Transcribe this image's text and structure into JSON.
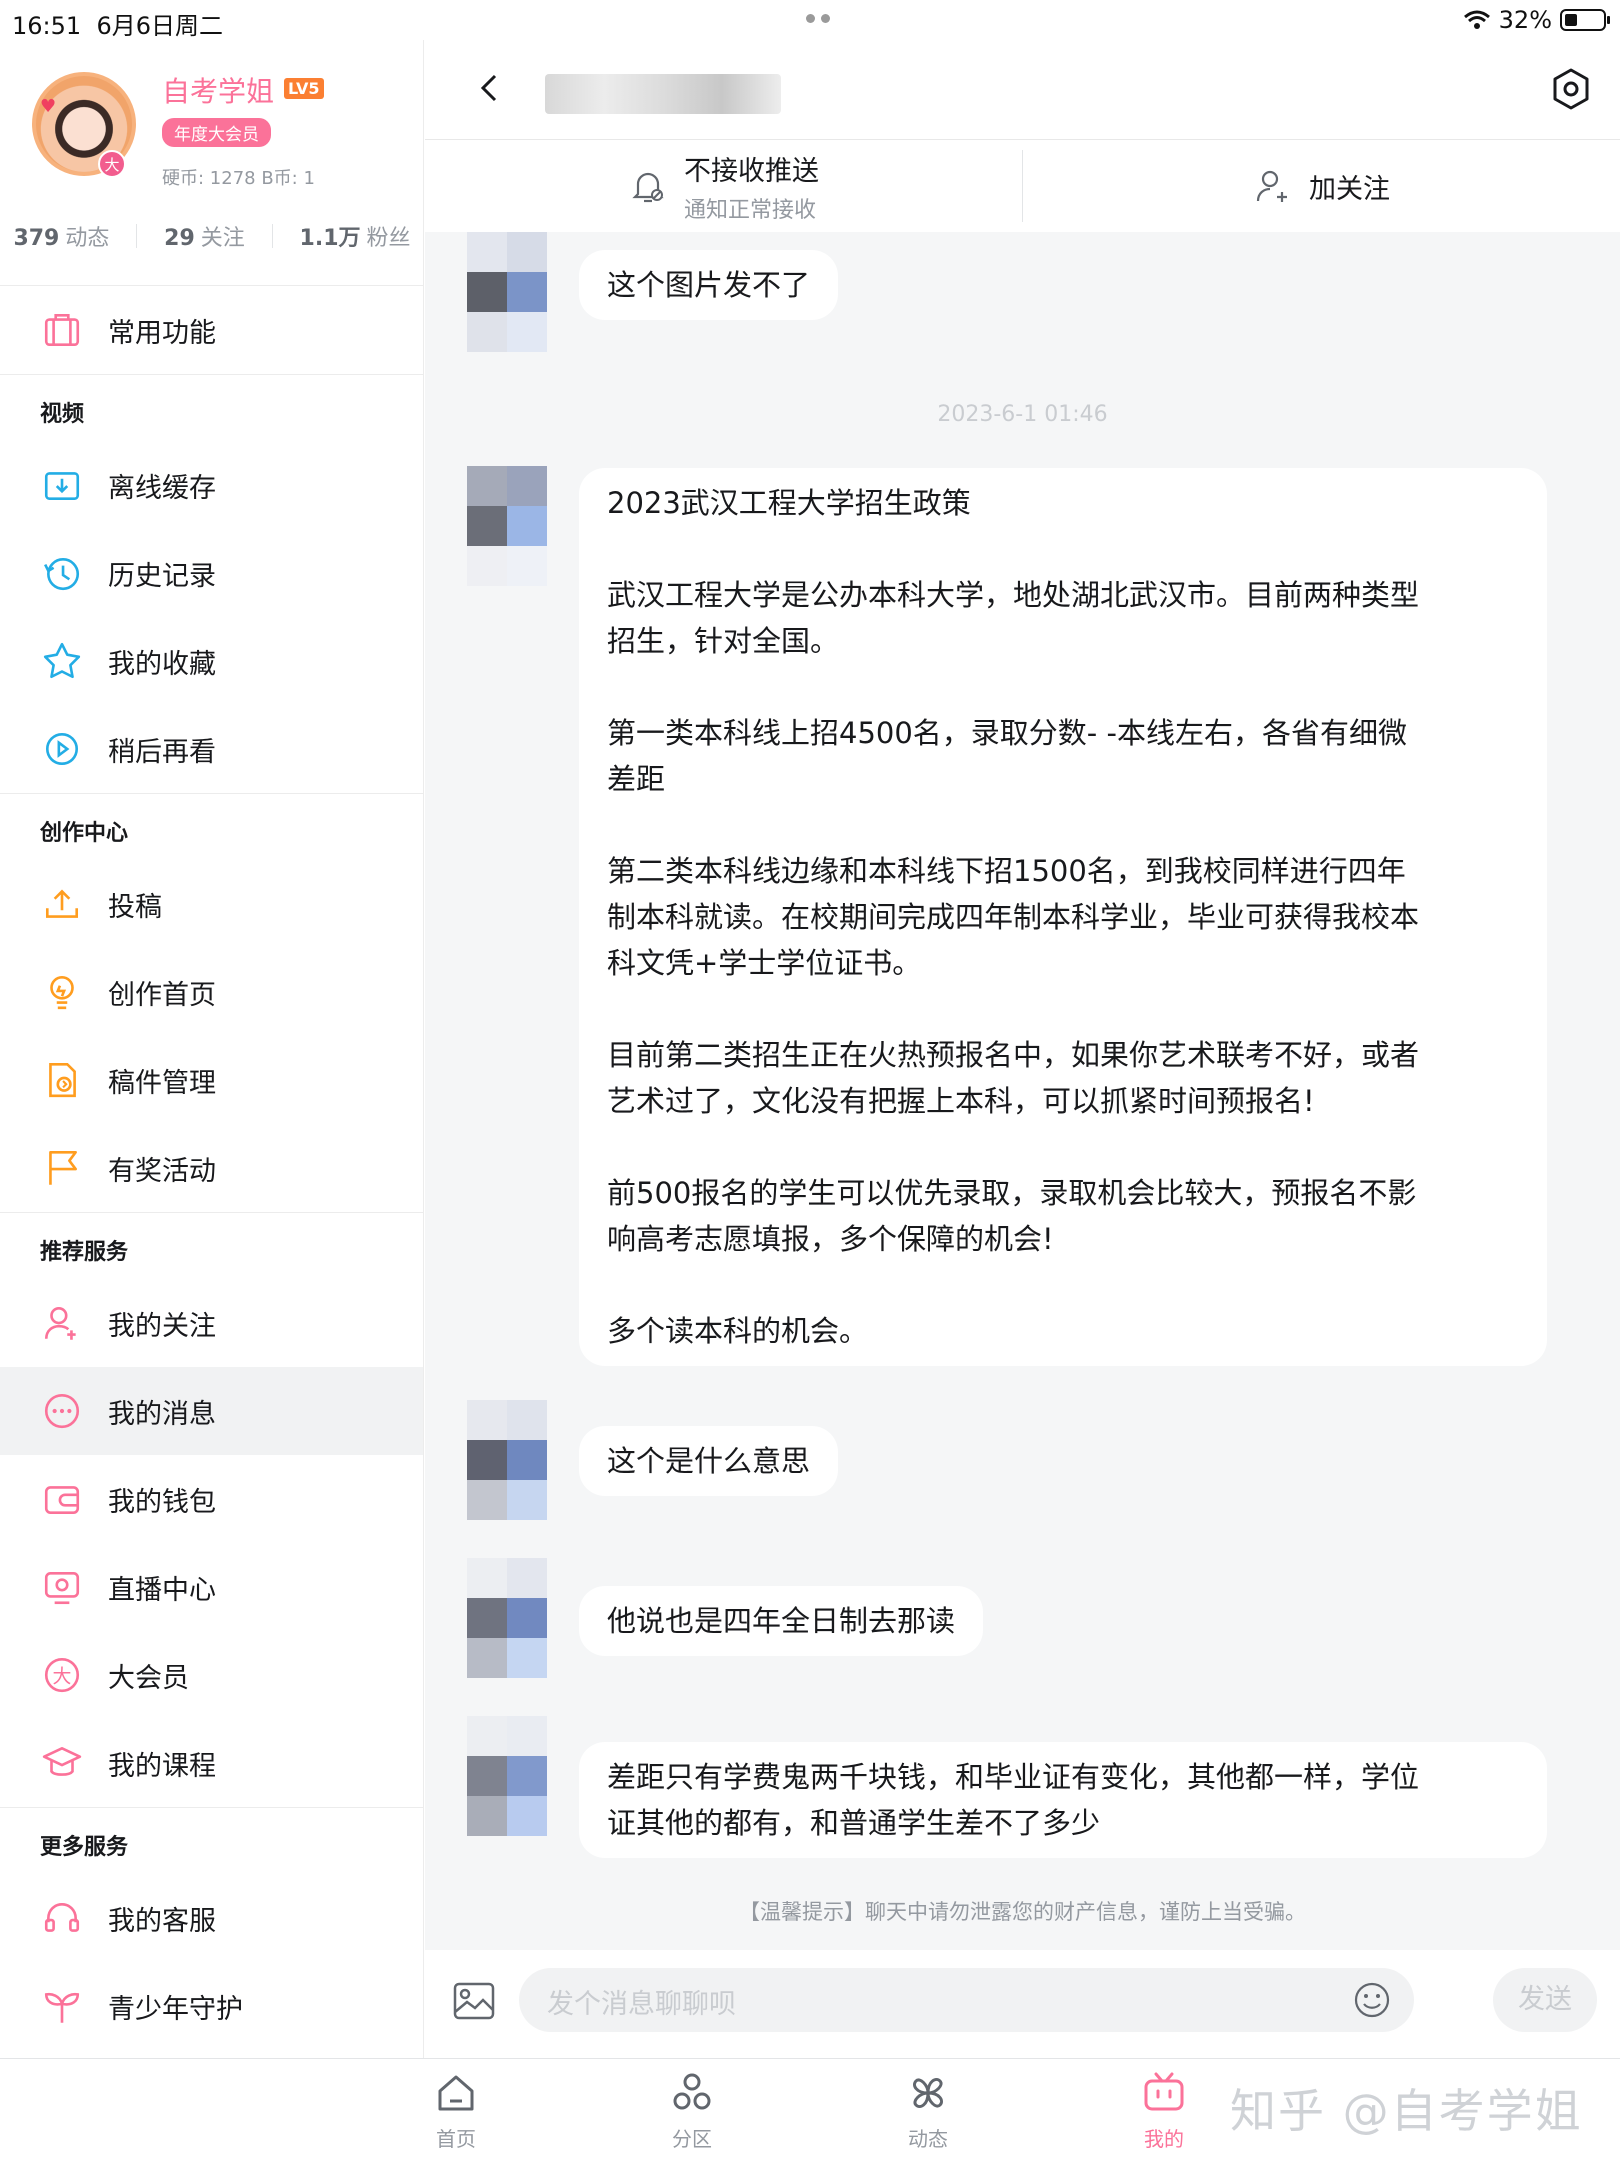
{
  "status": {
    "time": "16:51",
    "date": "6月6日周二",
    "battery": "32%"
  },
  "profile": {
    "name": "自考学姐",
    "level": "LV5",
    "vip": "年度大会员",
    "avatar_badge": "大",
    "coins": "硬币: 1278   B币: 1",
    "stats": [
      {
        "n": "379",
        "l": "动态"
      },
      {
        "n": "29",
        "l": "关注"
      },
      {
        "n": "1.1万",
        "l": "粉丝"
      }
    ]
  },
  "menu": {
    "common": "常用功能",
    "video_title": "视频",
    "video": [
      "离线缓存",
      "历史记录",
      "我的收藏",
      "稍后再看"
    ],
    "create_title": "创作中心",
    "create": [
      "投稿",
      "创作首页",
      "稿件管理",
      "有奖活动"
    ],
    "rec_title": "推荐服务",
    "rec": [
      "我的关注",
      "我的消息",
      "我的钱包",
      "直播中心",
      "大会员",
      "我的课程"
    ],
    "more_title": "更多服务",
    "more": [
      "我的客服",
      "青少年守护"
    ]
  },
  "chat": {
    "push_title": "不接收推送",
    "push_sub": "通知正常接收",
    "follow": "加关注",
    "messages": [
      {
        "text": "这个图片发不了"
      },
      {
        "text": "2023武汉工程大学招生政策\n\n武汉工程大学是公办本科大学，地处湖北武汉市。目前两种类型\n招生，针对全国。\n\n第一类本科线上招4500名，录取分数- -本线左右，各省有细微\n差距\n\n第二类本科线边缘和本科线下招1500名，到我校同样进行四年\n制本科就读。在校期间完成四年制本科学业，毕业可获得我校本\n科文凭+学士学位证书。\n\n目前第二类招生正在火热预报名中，如果你艺术联考不好，或者\n艺术过了，文化没有把握上本科，可以抓紧时间预报名!\n\n前500报名的学生可以优先录取，录取机会比较大，预报名不影\n响高考志愿填报，多个保障的机会!\n\n多个读本科的机会。"
      },
      {
        "text": "这个是什么意思"
      },
      {
        "text": "他说也是四年全日制去那读"
      },
      {
        "text": "差距只有学费鬼两千块钱，和毕业证有变化，其他都一样，学位\n证其他的都有，和普通学生差不了多少"
      }
    ],
    "timestamp": "2023-6-1 01:46",
    "tip": "【温馨提示】聊天中请勿泄露您的财产信息，谨防上当受骗。",
    "input_placeholder": "发个消息聊聊呗",
    "send": "发送"
  },
  "tabs": [
    "首页",
    "分区",
    "动态",
    "我的"
  ],
  "watermark": "知乎 @自考学姐",
  "colors": {
    "accent": "#fb7299",
    "level": "#fb7f32"
  }
}
